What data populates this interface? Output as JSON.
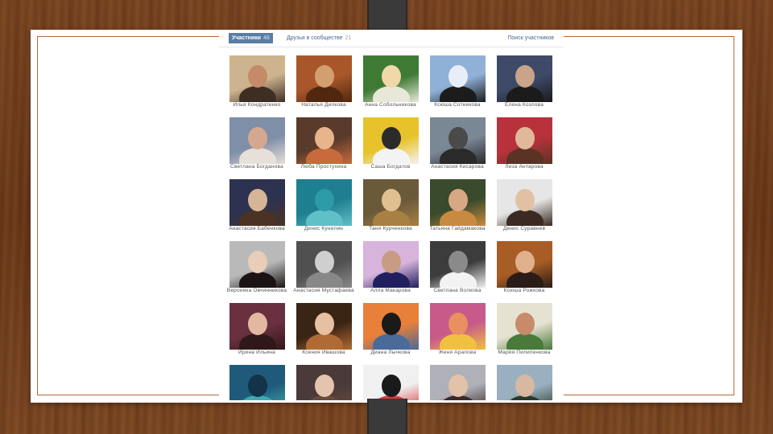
{
  "tabs": {
    "active": {
      "label": "Участники",
      "count": "48"
    },
    "friends": {
      "label": "Друзья в сообществе",
      "count": "21"
    },
    "right": {
      "label": "Поиск участников"
    }
  },
  "members": [
    {
      "name": "Илья Кондратенко",
      "colors": [
        "#cdb48f",
        "#3e2f22",
        "#c58b68"
      ]
    },
    {
      "name": "Наталья Дилкова",
      "colors": [
        "#a8562a",
        "#51280f",
        "#d2a070"
      ]
    },
    {
      "name": "Анна Собольникова",
      "colors": [
        "#3f7a35",
        "#e8e8d8",
        "#f0d8a8"
      ]
    },
    {
      "name": "Ксюша Сотникова",
      "colors": [
        "#8fb1d8",
        "#1c1c1c",
        "#e8eef8"
      ]
    },
    {
      "name": "Елена Козлова",
      "colors": [
        "#3e4a68",
        "#1b1b1b",
        "#c9a488"
      ]
    },
    {
      "name": "Светлана Богданова",
      "colors": [
        "#7f8fa8",
        "#e7e0d8",
        "#d4a890"
      ]
    },
    {
      "name": "Люба Простухина",
      "colors": [
        "#5a3b2b",
        "#c86a3e",
        "#e8b48c"
      ]
    },
    {
      "name": "Саша Богдатов",
      "colors": [
        "#e8c22a",
        "#f3f3f3",
        "#2b2b2b"
      ]
    },
    {
      "name": "Анастасия Кисарова",
      "colors": [
        "#7a8794",
        "#2a2a2a",
        "#4a4a4a"
      ]
    },
    {
      "name": "Лиза Антарова",
      "colors": [
        "#b8323c",
        "#5b3324",
        "#e1b89c"
      ]
    },
    {
      "name": "Анастасия Бабенкова",
      "colors": [
        "#2c3250",
        "#4b3224",
        "#d6b496"
      ]
    },
    {
      "name": "Денис Кунилин",
      "colors": [
        "#1e7f90",
        "#5fc0c8",
        "#2d9aa8"
      ]
    },
    {
      "name": "Таня Курченкова",
      "colors": [
        "#6a5a3a",
        "#a88044",
        "#e0c090"
      ]
    },
    {
      "name": "Татьяна Гайдамакова",
      "colors": [
        "#3a4a2c",
        "#c88a40",
        "#d7a884"
      ]
    },
    {
      "name": "Денис Суравнев",
      "colors": [
        "#e6e6e6",
        "#3a2a22",
        "#e2c0a4"
      ]
    },
    {
      "name": "Вероника Овчинникова",
      "colors": [
        "#b9b9b9",
        "#1c1414",
        "#e8cdb8"
      ]
    },
    {
      "name": "Анастасия Мустафаева",
      "colors": [
        "#505050",
        "#888888",
        "#cfcfcf"
      ]
    },
    {
      "name": "Алла Макарова",
      "colors": [
        "#d8b4dc",
        "#202060",
        "#c89c82"
      ]
    },
    {
      "name": "Светлана Волкова",
      "colors": [
        "#3c3c3c",
        "#f2f2f2",
        "#8a8a8a"
      ]
    },
    {
      "name": "Ксюша Рожкова",
      "colors": [
        "#a85d26",
        "#2a1c16",
        "#e0b08c"
      ]
    },
    {
      "name": "Ирина Ильина",
      "colors": [
        "#6a3040",
        "#301818",
        "#e4b8a0"
      ]
    },
    {
      "name": "Ксения Ивашова",
      "colors": [
        "#3a2414",
        "#b06a34",
        "#e6c0a0"
      ]
    },
    {
      "name": "Диана Лычкова",
      "colors": [
        "#e8803a",
        "#4a6a9a",
        "#1a1a1a"
      ]
    },
    {
      "name": "Женя Арапова",
      "colors": [
        "#c85a8a",
        "#f0c040",
        "#e89060"
      ]
    },
    {
      "name": "Мария Пилипенкова",
      "colors": [
        "#e6e2d2",
        "#4a7a3a",
        "#c88a6a"
      ]
    },
    {
      "name": "",
      "colors": [
        "#1f5a7a",
        "#40aab0",
        "#13334a"
      ]
    },
    {
      "name": "",
      "colors": [
        "#4a3a3a",
        "#6a4a3a",
        "#e4c4ac"
      ]
    },
    {
      "name": "",
      "colors": [
        "#f0f0f0",
        "#d83a3a",
        "#1a1a1a"
      ]
    },
    {
      "name": "",
      "colors": [
        "#b0b0b8",
        "#3a2a2a",
        "#e2c2a8"
      ]
    },
    {
      "name": "",
      "colors": [
        "#9ab0c0",
        "#2a3a2a",
        "#d8b8a0"
      ]
    }
  ]
}
